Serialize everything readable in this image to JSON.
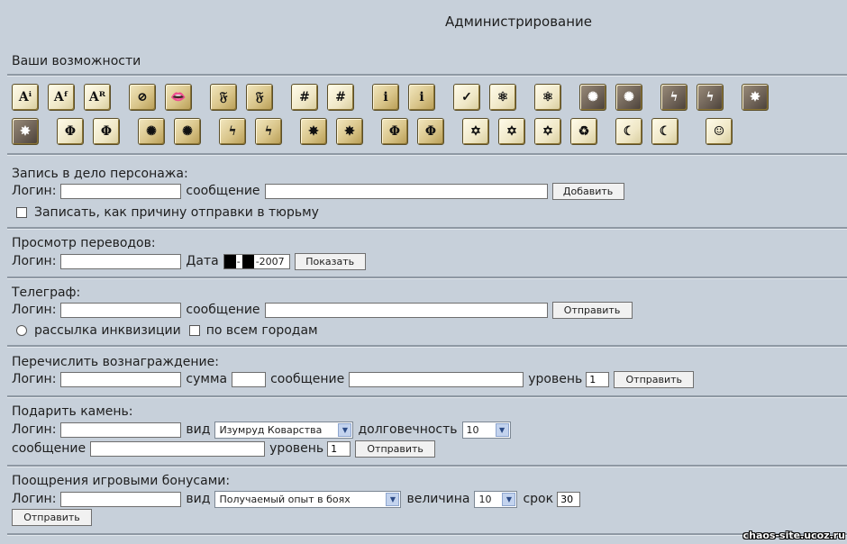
{
  "header": {
    "title": "Администрирование"
  },
  "abilities": {
    "title": "Ваши возможности",
    "row1": [
      {
        "icon": "character-info-icon",
        "glyph": "Aⁱ",
        "variant": "cream"
      },
      {
        "icon": "character-fight-icon",
        "glyph": "Aᶠ",
        "variant": "cream"
      },
      {
        "icon": "character-reputation-icon",
        "glyph": "Aᴿ",
        "variant": "cream"
      },
      {
        "icon": "no-silence-icon",
        "glyph": "⊘",
        "variant": "gold"
      },
      {
        "icon": "lips-icon",
        "glyph": "👄",
        "variant": "gold"
      },
      {
        "icon": "forum-f-icon",
        "glyph": "𝔉",
        "variant": "gold"
      },
      {
        "icon": "forum-f-green-icon",
        "glyph": "𝔉",
        "variant": "gold"
      },
      {
        "icon": "hash-red-icon",
        "glyph": "#",
        "variant": "cream"
      },
      {
        "icon": "hash-green-icon",
        "glyph": "#",
        "variant": "cream"
      },
      {
        "icon": "no-info-icon",
        "glyph": "i",
        "variant": "gold"
      },
      {
        "icon": "info-green-icon",
        "glyph": "i",
        "variant": "gold"
      },
      {
        "icon": "person-check-icon",
        "glyph": "✓",
        "variant": "cream"
      },
      {
        "icon": "atom-icon",
        "glyph": "⚛",
        "variant": "cream"
      },
      {
        "icon": "person-atom-icon",
        "glyph": "⚛",
        "variant": "cream"
      },
      {
        "icon": "spiral-icon",
        "glyph": "✺",
        "variant": "dark"
      },
      {
        "icon": "spiral-cross-icon",
        "glyph": "✺",
        "variant": "dark"
      },
      {
        "icon": "lightning-icon",
        "glyph": "ϟ",
        "variant": "dark"
      },
      {
        "icon": "lightning-cross-icon",
        "glyph": "ϟ",
        "variant": "dark"
      },
      {
        "icon": "explosion-icon",
        "glyph": "✸",
        "variant": "dark"
      }
    ],
    "row2": [
      {
        "icon": "explosion-cross-icon",
        "glyph": "✸",
        "variant": "dark"
      },
      {
        "icon": "phi-icon",
        "glyph": "Φ",
        "variant": "cream"
      },
      {
        "icon": "phi-cross-icon",
        "glyph": "Φ",
        "variant": "cream"
      },
      {
        "icon": "spiral-gold-icon",
        "glyph": "✺",
        "variant": "gold"
      },
      {
        "icon": "spiral-gold-cross-icon",
        "glyph": "✺",
        "variant": "gold"
      },
      {
        "icon": "lightning-gold-icon",
        "glyph": "ϟ",
        "variant": "gold"
      },
      {
        "icon": "lightning-gold-cross-icon",
        "glyph": "ϟ",
        "variant": "gold"
      },
      {
        "icon": "explosion-gold-icon",
        "glyph": "✸",
        "variant": "gold"
      },
      {
        "icon": "explosion-gold-cross-icon",
        "glyph": "✸",
        "variant": "gold"
      },
      {
        "icon": "phi-gold-icon",
        "glyph": "Φ",
        "variant": "gold"
      },
      {
        "icon": "phi-gold-cross-icon",
        "glyph": "Φ",
        "variant": "gold"
      },
      {
        "icon": "star-no-icon",
        "glyph": "✡",
        "variant": "cream"
      },
      {
        "icon": "star-check-icon",
        "glyph": "✡",
        "variant": "cream"
      },
      {
        "icon": "star-red-icon",
        "glyph": "✡",
        "variant": "cream"
      },
      {
        "icon": "recycle-icon",
        "glyph": "♻",
        "variant": "cream"
      },
      {
        "icon": "plus-moon-icon",
        "glyph": "☾",
        "variant": "cream"
      },
      {
        "icon": "info-moon-icon",
        "glyph": "☾",
        "variant": "cream"
      },
      {
        "icon": "coins-icon",
        "glyph": "☺",
        "variant": "cream"
      }
    ]
  },
  "record": {
    "title": "Запись в дело персонажа:",
    "login_label": "Логин:",
    "login_value": "",
    "message_label": "сообщение",
    "message_value": "",
    "add_button": "Добавить",
    "jail_checkbox_label": "Записать, как причину отправки в тюрьму"
  },
  "transfers": {
    "title": "Просмотр переводов:",
    "login_label": "Логин:",
    "login_value": "",
    "date_label": "Дата",
    "year_suffix": "-2007",
    "show_button": "Показать"
  },
  "telegraph": {
    "title": "Телеграф:",
    "login_label": "Логин:",
    "login_value": "",
    "message_label": "сообщение",
    "message_value": "",
    "send_button": "Отправить",
    "inquisition_label": "рассылка инквизиции",
    "all_cities_label": "по всем городам"
  },
  "reward": {
    "title": "Перечислить вознаграждение:",
    "login_label": "Логин:",
    "login_value": "",
    "sum_label": "сумма",
    "sum_value": "",
    "message_label": "сообщение",
    "message_value": "",
    "level_label": "уровень",
    "level_value": "1",
    "send_button": "Отправить"
  },
  "stone": {
    "title": "Подарить камень:",
    "login_label": "Логин:",
    "login_value": "",
    "type_label": "вид",
    "type_selected": "Изумруд Коварства",
    "durability_label": "долговечность",
    "durability_selected": "10",
    "message_label": "сообщение",
    "message_value": "",
    "level_label": "уровень",
    "level_value": "1",
    "send_button": "Отправить"
  },
  "bonus": {
    "title": "Поощрения игровыми бонусами:",
    "login_label": "Логин:",
    "login_value": "",
    "type_label": "вид",
    "type_selected": "Получаемый опыт в боях",
    "amount_label": "величина",
    "amount_selected": "10",
    "term_label": "срок",
    "term_value": "30",
    "send_button": "Отправить"
  },
  "footer": {
    "watermark": "chaos-site.ucoz.ru"
  }
}
